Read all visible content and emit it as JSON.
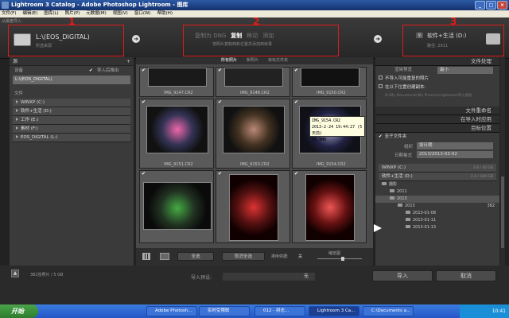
{
  "window": {
    "title": "Lightroom 3 Catalog - Adobe Photoshop Lightroom - 图库",
    "min": "_",
    "max": "□",
    "close": "×"
  },
  "menu": [
    "文件(F)",
    "编辑(E)",
    "图库(L)",
    "照片(P)",
    "元数据(M)",
    "视图(V)",
    "窗口(W)",
    "帮助(H)"
  ],
  "tab_label": "从磁盘导入",
  "source": {
    "name": "L:\\(EOS_DIGITAL)",
    "sub": "所选来源",
    "num": "1"
  },
  "mode": {
    "options": [
      "复制为 DNG",
      "复制",
      "移动",
      "添加"
    ],
    "active": "复制",
    "desc": "将照片复制到新位置并添加到目录",
    "num": "2"
  },
  "dest": {
    "name": "软件+生活 (D:)",
    "sub": "路径: 2011",
    "num": "3"
  },
  "left": {
    "header": "源",
    "device": "设备",
    "eject": "导入后推出",
    "eject_checked": "✔",
    "eos_path": "L:\\(EOS_DIGITAL)",
    "files": "文件",
    "drives": [
      "WINXP (C:)",
      "软件+生活 (D:)",
      "工作 (E:)",
      "素材 (F:)",
      "EOS_DIGITAL (L:)"
    ]
  },
  "grid": {
    "tabs": [
      "所有照片",
      "新照片",
      "目标文件夹"
    ],
    "active": 0,
    "rows": [
      [
        {
          "name": "IMG_9147.CR2",
          "c": "✔"
        },
        {
          "name": "IMG_9148.CR2",
          "c": "✔"
        },
        {
          "name": "IMG_9150.CR2",
          "c": "✔"
        }
      ],
      [
        {
          "name": "IMG_9151.CR2",
          "c": "✔"
        },
        {
          "name": "IMG_9153.CR2",
          "c": "✔"
        },
        {
          "name": "IMG_9154.CR2",
          "c": "✔"
        }
      ],
      [
        {
          "name": "IMG_9152.CR2",
          "c": "✔"
        },
        {
          "name": "IMG_9156.CR2",
          "c": "✔"
        },
        {
          "name": "IMG_9155.CR2",
          "c": "✔"
        }
      ]
    ],
    "tooltip": [
      "IMG_9154.CR2",
      "2013-2-24 19:44:27 (5 天前)",
      "24.9MB"
    ]
  },
  "toolbar": {
    "check_all": "全选",
    "uncheck_all": "取消全选",
    "sort_label": "排序依据:",
    "sort_value": "关",
    "size_label": "缩览图"
  },
  "right": {
    "file_handling": "文件处理",
    "preview_label": "渲染预览",
    "preview_value": "最小",
    "dup": "不导入可能重复的照片",
    "second_copy": "在以下位置创建副本:",
    "second_path": "D:\\My Documents\\My Pictures\\Lightroom导入备份",
    "rename": "文件重命名",
    "apply": "在导入时应用",
    "destination": "目标位置",
    "subfolder": "至子文件夹",
    "organize_label": "组织",
    "organize_value": "按日期",
    "date_label": "日期格式",
    "date_value": "2013/2013-03-02",
    "drives": [
      {
        "name": "WINXP (C:)",
        "size": "3.8 / 40 GB"
      },
      {
        "name": "软件+生活 (D:)",
        "size": "2.4 / 180 GB"
      }
    ],
    "tree": [
      {
        "label": "摄影",
        "lvl": 0
      },
      {
        "label": "2011",
        "lvl": 1
      },
      {
        "label": "2013",
        "lvl": 1
      },
      {
        "label": "2013",
        "lvl": 2,
        "count": "382"
      },
      {
        "label": "2013-01-08",
        "lvl": 3
      },
      {
        "label": "2013-01-11",
        "lvl": 3
      },
      {
        "label": "2013-01-13",
        "lvl": 3
      }
    ]
  },
  "bottom": {
    "summary": "382张照片 / 5 GB",
    "preset_label": "导入预设:",
    "preset_value": "无",
    "import": "导入",
    "cancel": "取消"
  },
  "taskbar": {
    "start": "开始",
    "items": [
      "Adobe Photosh...",
      "实时受限联",
      "012 - 拼志...",
      "Lightroom 3 Ca...",
      "C:\\Documents a..."
    ],
    "time": "10:41"
  }
}
